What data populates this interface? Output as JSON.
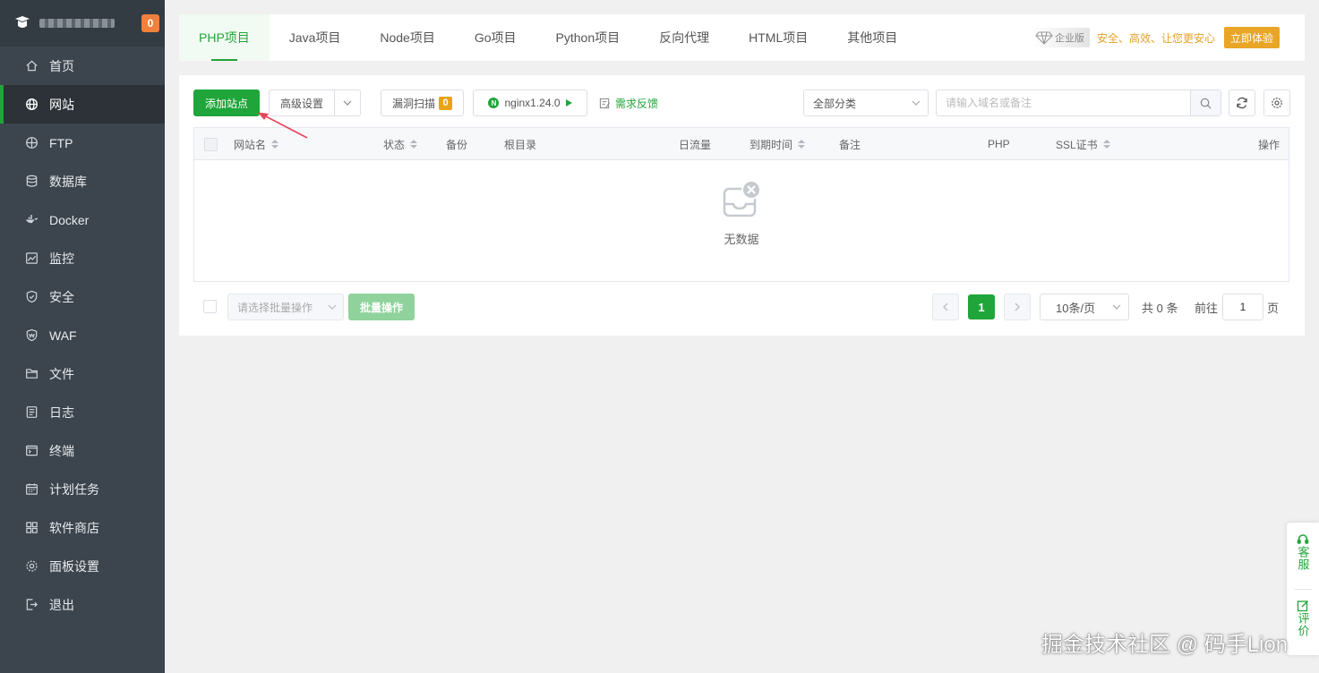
{
  "sidebar": {
    "badge": "0",
    "items": [
      {
        "label": "首页",
        "icon": "home-icon"
      },
      {
        "label": "网站",
        "icon": "globe-icon"
      },
      {
        "label": "FTP",
        "icon": "ftp-icon"
      },
      {
        "label": "数据库",
        "icon": "database-icon"
      },
      {
        "label": "Docker",
        "icon": "docker-icon"
      },
      {
        "label": "监控",
        "icon": "monitor-icon"
      },
      {
        "label": "安全",
        "icon": "shield-icon"
      },
      {
        "label": "WAF",
        "icon": "waf-icon"
      },
      {
        "label": "文件",
        "icon": "folder-icon"
      },
      {
        "label": "日志",
        "icon": "log-icon"
      },
      {
        "label": "终端",
        "icon": "terminal-icon"
      },
      {
        "label": "计划任务",
        "icon": "calendar-icon"
      },
      {
        "label": "软件商店",
        "icon": "apps-icon"
      },
      {
        "label": "面板设置",
        "icon": "gear-icon"
      },
      {
        "label": "退出",
        "icon": "logout-icon"
      }
    ],
    "active_index": 1
  },
  "tabs": [
    {
      "label": "PHP项目"
    },
    {
      "label": "Java项目"
    },
    {
      "label": "Node项目"
    },
    {
      "label": "Go项目"
    },
    {
      "label": "Python项目"
    },
    {
      "label": "反向代理"
    },
    {
      "label": "HTML项目"
    },
    {
      "label": "其他项目"
    }
  ],
  "enterprise": {
    "badge": "企业版",
    "slogan": "安全、高效、让您更安心",
    "button": "立即体验"
  },
  "toolbar": {
    "add_site": "添加站点",
    "advanced": "高级设置",
    "vuln_scan": "漏洞扫描",
    "vuln_count": "0",
    "nginx": "nginx1.24.0",
    "feedback": "需求反馈",
    "category": "全部分类",
    "search_placeholder": "请输入域名或备注"
  },
  "table": {
    "columns": [
      "网站名",
      "状态",
      "备份",
      "根目录",
      "日流量",
      "到期时间",
      "备注",
      "PHP",
      "SSL证书",
      "操作"
    ],
    "empty_text": "无数据"
  },
  "footer": {
    "bulk_placeholder": "请选择批量操作",
    "bulk_button": "批量操作",
    "current_page": "1",
    "page_size": "10条/页",
    "total": "共 0 条",
    "goto_label": "前往",
    "goto_value": "1",
    "page_suffix": "页"
  },
  "float": {
    "service": "客服",
    "review": "评价"
  },
  "watermark": "掘金技术社区 @ 码手Lion",
  "colors": {
    "accent": "#20a53a",
    "sidebar_bg": "#3c444d",
    "badge_orange": "#f0803c",
    "enterprise_gold": "#e9a525"
  }
}
